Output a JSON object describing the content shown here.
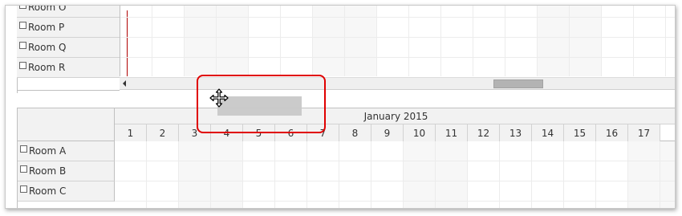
{
  "top_scheduler": {
    "rows": [
      {
        "label": "Room O"
      },
      {
        "label": "Room P"
      },
      {
        "label": "Room Q"
      },
      {
        "label": "Room R"
      }
    ]
  },
  "bottom_scheduler": {
    "month": "January 2015",
    "days": [
      "1",
      "2",
      "3",
      "4",
      "5",
      "6",
      "7",
      "8",
      "9",
      "10",
      "11",
      "12",
      "13",
      "14",
      "15",
      "16",
      "17"
    ],
    "rows": [
      {
        "label": "Room A"
      },
      {
        "label": "Room B"
      },
      {
        "label": "Room C"
      }
    ]
  },
  "icons": {
    "drag": "move-cursor-icon",
    "scroll_left": "scroll-left-arrow-icon"
  },
  "colors": {
    "drag_highlight": "#e00000",
    "today_line": "#b00000",
    "header_bg": "#f2f2f2"
  }
}
